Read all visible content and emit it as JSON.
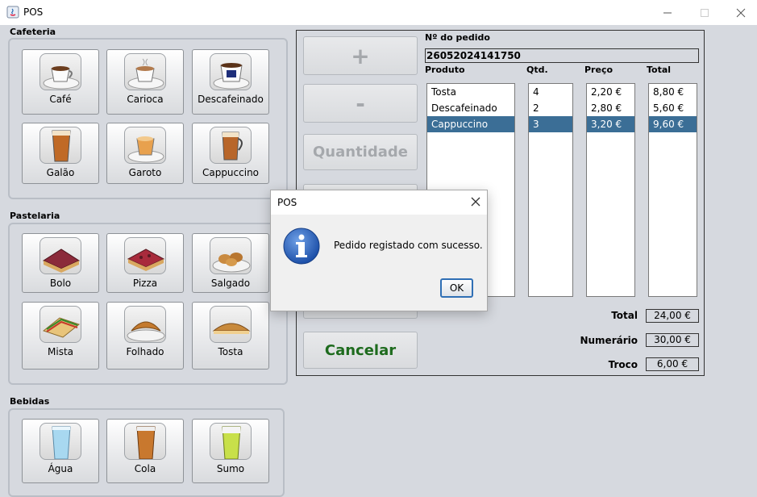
{
  "window": {
    "title": "POS"
  },
  "groups": {
    "cafeteria": {
      "label": "Cafeteria",
      "items": [
        "Café",
        "Carioca",
        "Descafeinado",
        "Galão",
        "Garoto",
        "Cappuccino"
      ]
    },
    "pastelaria": {
      "label": "Pastelaria",
      "items": [
        "Bolo",
        "Pizza",
        "Salgado",
        "Mista",
        "Folhado",
        "Tosta"
      ]
    },
    "bebidas": {
      "label": "Bebidas",
      "items": [
        "Água",
        "Cola",
        "Sumo"
      ]
    }
  },
  "actions": {
    "plus": "+",
    "minus": "-",
    "quantity": "Quantidade",
    "cancel": "Cancelar"
  },
  "order": {
    "number_label": "Nº do pedido",
    "number": "26052024141750",
    "headers": {
      "product": "Produto",
      "qty": "Qtd.",
      "price": "Preço",
      "total": "Total"
    },
    "rows": [
      {
        "product": "Tosta",
        "qty": "4",
        "price": "2,20 €",
        "total": "8,80 €"
      },
      {
        "product": "Descafeinado",
        "qty": "2",
        "price": "2,80 €",
        "total": "5,60 €"
      },
      {
        "product": "Cappuccino",
        "qty": "3",
        "price": "3,20 €",
        "total": "9,60 €"
      }
    ],
    "selected_row": 2,
    "summary": {
      "total_label": "Total",
      "total": "24,00 €",
      "cash_label": "Numerário",
      "cash": "30,00 €",
      "change_label": "Troco",
      "change": "6,00 €"
    }
  },
  "dialog": {
    "title": "POS",
    "message": "Pedido registado com sucesso.",
    "ok": "OK",
    "icon": "info-icon"
  },
  "colors": {
    "selection": "#3b6e96",
    "cancel_text": "#1e6b1e",
    "dialog_button_border": "#2f6fb5"
  }
}
